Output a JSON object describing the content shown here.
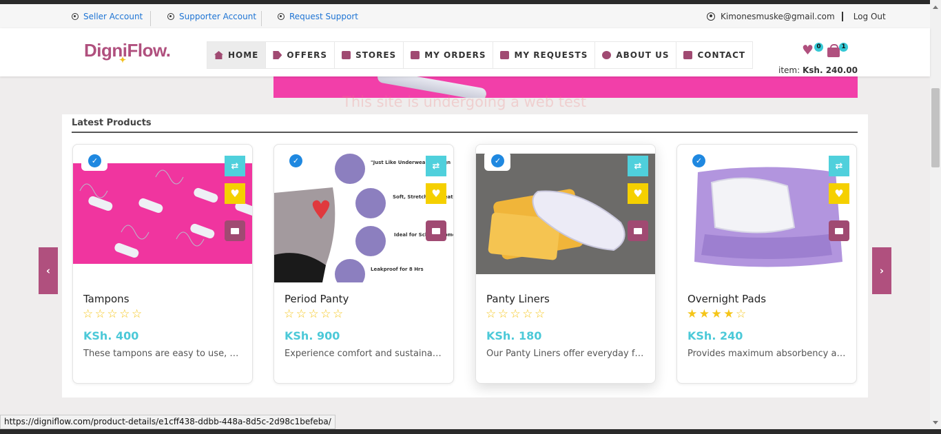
{
  "topbar": {
    "seller_account": "Seller Account",
    "supporter_account": "Supporter Account",
    "request_support": "Request Support",
    "user_email": "Kimonesmuske@gmail.com",
    "logout": "Log Out"
  },
  "header": {
    "logo": "DigniFlow.",
    "nav": [
      {
        "label": "HOME",
        "icon": "home-icon",
        "active": true
      },
      {
        "label": "OFFERS",
        "icon": "tag-icon"
      },
      {
        "label": "STORES",
        "icon": "store-icon"
      },
      {
        "label": "MY ORDERS",
        "icon": "briefcase-icon"
      },
      {
        "label": "MY REQUESTS",
        "icon": "briefcase-icon"
      },
      {
        "label": "ABOUT US",
        "icon": "info-icon"
      },
      {
        "label": "CONTACT",
        "icon": "envelope-icon"
      }
    ],
    "wishlist_count": "0",
    "cart_count": "1",
    "item_label": "item:",
    "item_total": "Ksh. 240.00"
  },
  "watermark": "This site is undergoing a web test",
  "section": {
    "title": "Latest Products"
  },
  "products": [
    {
      "name": "Tampons",
      "stars": "☆☆☆☆☆",
      "price": "KSh. 400",
      "desc": "These tampons are easy to use, comfortable and reliable"
    },
    {
      "name": "Period Panty",
      "stars": "☆☆☆☆☆",
      "price": "KSh. 900",
      "desc": "Experience comfort and sustainability with our period panty"
    },
    {
      "name": "Panty Liners",
      "stars": "☆☆☆☆☆",
      "price": "KSh. 180",
      "desc": "Our Panty Liners offer everyday freshness and protection"
    },
    {
      "name": "Overnight Pads",
      "stars": "★★★★☆",
      "price": "KSh. 240",
      "desc": "Provides maximum absorbency and comfort all night long"
    }
  ],
  "period_panty_features": [
    "\"Just Like Underwear\" Design",
    "Soft, Stretchy & Breathable",
    "Ideal for School, Home & Play",
    "Leakproof for 8 Hrs"
  ],
  "carousel": {
    "prev": "‹",
    "next": "›"
  },
  "status_url": "https://digniflow.com/product-details/e1cff438-ddbb-448a-8d5c-2d98c1befeba/",
  "colors": {
    "brand": "#b0507e",
    "accent": "#4cc9d8",
    "wish": "#f5d000",
    "banner": "#f23fa9"
  }
}
